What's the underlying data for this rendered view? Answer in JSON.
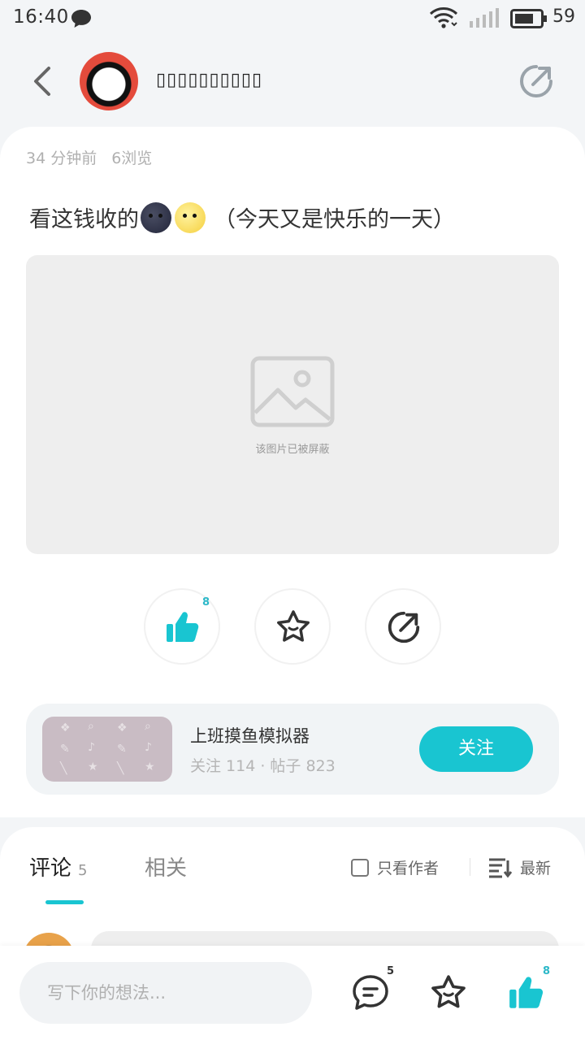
{
  "status_bar": {
    "time": "16:40",
    "battery": "59",
    "icons": [
      "chat-bubble-icon",
      "wifi-icon",
      "signal-icon",
      "battery-icon"
    ]
  },
  "header": {
    "username": "▯▯▯▯▯▯▯▯▯▯",
    "back_icon": "chevron-left-icon",
    "share_icon": "share-icon"
  },
  "post": {
    "time_ago": "34 分钟前",
    "views": "6浏览",
    "text_prefix": "看这钱收的",
    "text_suffix": "（今天又是快乐的一天）",
    "emojis": [
      "new-moon-face",
      "full-moon-face"
    ],
    "blocked_image_text": "该图片已被屏蔽"
  },
  "actions": {
    "like_count": "8",
    "icons": [
      "thumbs-up-icon",
      "star-icon",
      "share-icon"
    ]
  },
  "collection": {
    "title": "上班摸鱼模拟器",
    "stats": "关注 114 · 帖子 823",
    "follow_label": "关注"
  },
  "comments": {
    "tab_comments": "评论",
    "comment_count": "5",
    "tab_related": "相关",
    "only_author": "只看作者",
    "sort_label": "最新"
  },
  "bottom_bar": {
    "input_placeholder": "写下你的想法...",
    "comment_count": "5",
    "like_count": "8"
  },
  "colors": {
    "accent": "#19c5d1",
    "background": "#f3f5f7",
    "card": "#ffffff"
  }
}
